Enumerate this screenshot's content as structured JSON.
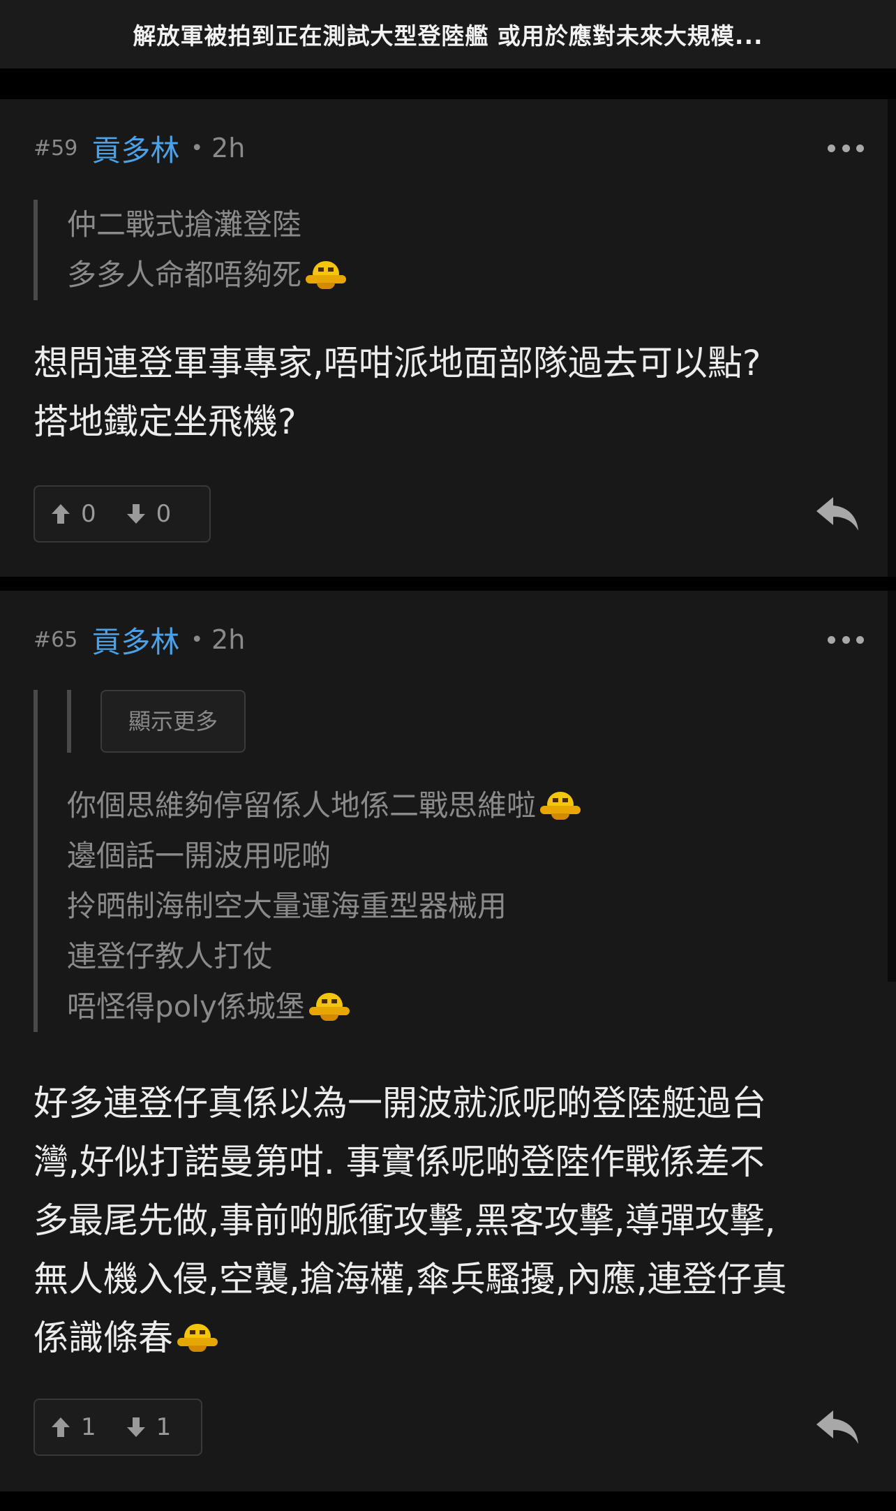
{
  "header": {
    "title": "解放軍被拍到正在測試大型登陸艦 或用於應對未來大規模..."
  },
  "posts": [
    {
      "floor": "#59",
      "username": "貢多林",
      "dot": "•",
      "time": "2h",
      "quote_lines": [
        "仲二戰式搶灘登陸",
        "多多人命都唔夠死"
      ],
      "content_lines": [
        "想問連登軍事專家,唔咁派地面部隊過去可以點?",
        "搭地鐵定坐飛機?"
      ],
      "upvotes": "0",
      "downvotes": "0"
    },
    {
      "floor": "#65",
      "username": "貢多林",
      "dot": "•",
      "time": "2h",
      "show_more_label": "顯示更多",
      "quote_lines": [
        "你個思維夠停留係人地係二戰思維啦",
        "邊個話一開波用呢啲",
        "拎晒制海制空大量運海重型器械用",
        "連登仔教人打仗",
        "唔怪得poly係城堡"
      ],
      "content_lines": [
        "好多連登仔真係以為一開波就派呢啲登陸艇過台",
        "灣,好似打諾曼第咁. 事實係呢啲登陸作戰係差不",
        "多最尾先做,事前啲脈衝攻擊,黑客攻擊,導彈攻擊,",
        "無人機入侵,空襲,搶海權,傘兵騷擾,內應,連登仔真",
        "係識條春"
      ],
      "upvotes": "1",
      "downvotes": "1"
    }
  ],
  "icons": {
    "more": "more-icon",
    "upvote": "arrow-up-icon",
    "downvote": "arrow-down-icon",
    "reply": "reply-icon",
    "emoji": "sticker-emoji-icon"
  },
  "colors": {
    "background": "#181818",
    "username": "#4aa3ea",
    "muted": "#8a8a8a",
    "text": "#ececec"
  }
}
